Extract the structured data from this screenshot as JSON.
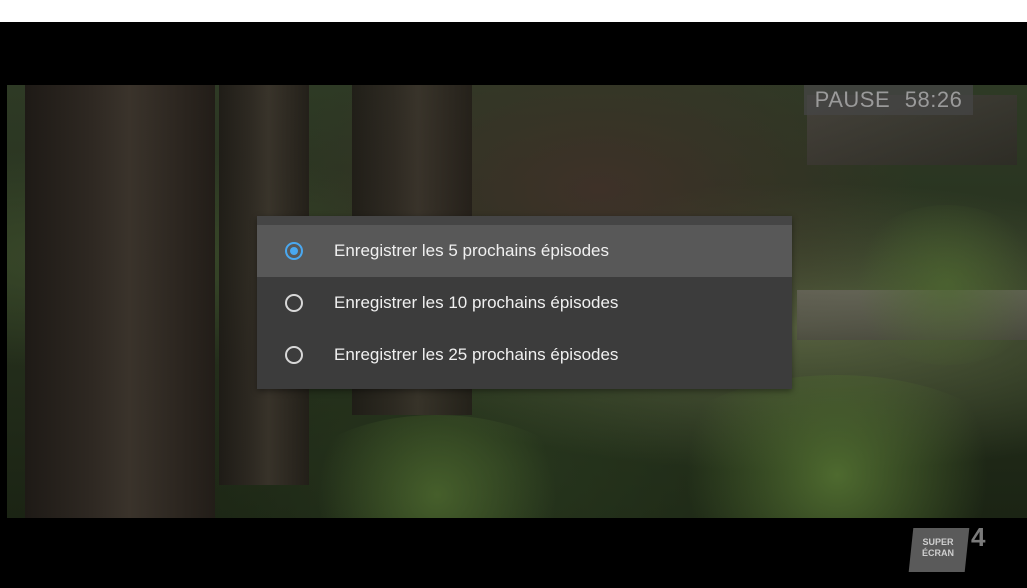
{
  "osd": {
    "state": "PAUSE",
    "time": "58:26"
  },
  "record_menu": {
    "selected_index": 0,
    "options": [
      {
        "label": "Enregistrer les 5 prochains épisodes",
        "selected": true
      },
      {
        "label": "Enregistrer les 10 prochains épisodes",
        "selected": false
      },
      {
        "label": "Enregistrer les 25 prochains épisodes",
        "selected": false
      }
    ]
  },
  "channel_logo": {
    "line1": "SUPER",
    "line2": "ÉCRAN",
    "number": "4"
  },
  "colors": {
    "accent": "#4aa8f0",
    "menu_bg": "#3c3c3c",
    "menu_selected_bg": "#585858"
  }
}
